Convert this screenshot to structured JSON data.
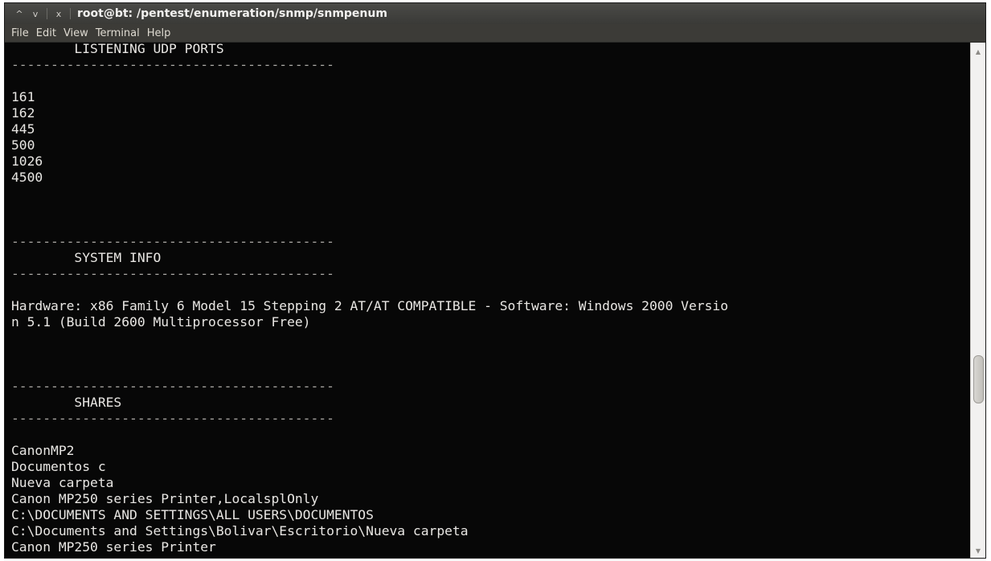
{
  "window": {
    "title": "root@bt: /pentest/enumeration/snmp/snmpenum",
    "controls": {
      "minimize_glyph": "^",
      "maximize_glyph": "v",
      "close_glyph": "x"
    }
  },
  "menu": {
    "items": [
      "File",
      "Edit",
      "View",
      "Terminal",
      "Help"
    ]
  },
  "terminal": {
    "lines": [
      "        LISTENING UDP PORTS",
      "-----------------------------------------",
      "",
      "161",
      "162",
      "445",
      "500",
      "1026",
      "4500",
      "",
      "",
      "",
      "-----------------------------------------",
      "        SYSTEM INFO",
      "-----------------------------------------",
      "",
      "Hardware: x86 Family 6 Model 15 Stepping 2 AT/AT COMPATIBLE - Software: Windows 2000 Versio",
      "n 5.1 (Build 2600 Multiprocessor Free)",
      "",
      "",
      "",
      "-----------------------------------------",
      "        SHARES",
      "-----------------------------------------",
      "",
      "CanonMP2",
      "Documentos c",
      "Nueva carpeta",
      "Canon MP250 series Printer,LocalsplOnly",
      "C:\\DOCUMENTS AND SETTINGS\\ALL USERS\\DOCUMENTOS",
      "C:\\Documents and Settings\\Bolivar\\Escritorio\\Nueva carpeta",
      "Canon MP250 series Printer"
    ]
  },
  "scrollbar": {
    "position_fraction": 0.68,
    "up_arrow_icon": "chevron-up-icon",
    "down_arrow_icon": "chevron-down-icon"
  },
  "colors": {
    "terminal_background": "#070707",
    "terminal_foreground": "#e8e6e3",
    "titlebar": "#3c3b37"
  }
}
